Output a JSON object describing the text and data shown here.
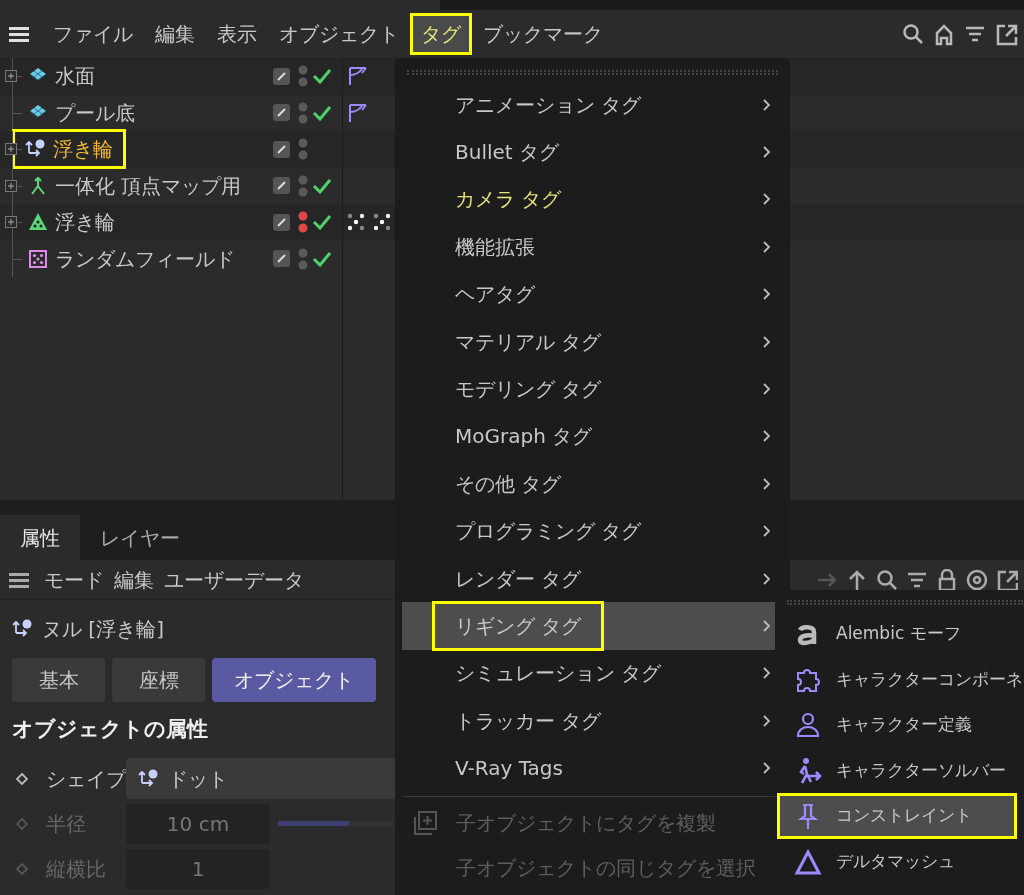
{
  "menubar": {
    "items": [
      {
        "label": "ファイル",
        "selected": false,
        "highlighted": false
      },
      {
        "label": "編集",
        "selected": false,
        "highlighted": false
      },
      {
        "label": "表示",
        "selected": false,
        "highlighted": false
      },
      {
        "label": "オブジェクト",
        "selected": false,
        "highlighted": false
      },
      {
        "label": "タグ",
        "selected": true,
        "highlighted": true
      },
      {
        "label": "ブックマーク",
        "selected": false,
        "highlighted": false
      }
    ]
  },
  "object_list": {
    "rows": [
      {
        "name": "水面",
        "kind": "plane",
        "expandable": true,
        "selected": false,
        "highlighted": false,
        "color": "#5a5a5a",
        "checked": true,
        "tags": [
          {
            "kind": "phong"
          }
        ]
      },
      {
        "name": "プール底",
        "kind": "plane",
        "expandable": false,
        "selected": false,
        "highlighted": false,
        "color": "#5a5a5a",
        "checked": true,
        "tags": [
          {
            "kind": "phong"
          }
        ]
      },
      {
        "name": "浮き輪",
        "kind": "null",
        "expandable": true,
        "selected": true,
        "highlighted": true,
        "color": "#5a5a5a",
        "checked": false
      },
      {
        "name": "一体化 頂点マップ用",
        "kind": "connect",
        "expandable": true,
        "selected": false,
        "highlighted": false,
        "color": "#5a5a5a",
        "checked": true
      },
      {
        "name": "浮き輪",
        "kind": "cloner",
        "expandable": true,
        "selected": false,
        "highlighted": false,
        "color": "#e04848",
        "checked": true,
        "tags": [
          {
            "kind": "dots"
          },
          {
            "kind": "dots"
          }
        ]
      },
      {
        "name": "ランダムフィールド",
        "kind": "field",
        "expandable": false,
        "selected": false,
        "highlighted": false,
        "color": "#5a5a5a",
        "checked": true
      }
    ]
  },
  "attributes": {
    "tabs": [
      {
        "label": "属性",
        "selected": true
      },
      {
        "label": "レイヤー",
        "selected": false
      }
    ],
    "menu": [
      "モード",
      "編集",
      "ユーザーデータ"
    ],
    "object_title": "ヌル [浮き輪]",
    "sub_tabs": [
      {
        "label": "基本",
        "selected": false
      },
      {
        "label": "座標",
        "selected": false
      },
      {
        "label": "オブジェクト",
        "selected": true
      }
    ],
    "section_title": "オブジェクトの属性",
    "fields": [
      {
        "kind": "dropdown",
        "label": "シェイプ",
        "value": "ドット",
        "disabled": false
      },
      {
        "kind": "slider",
        "label": "半径",
        "value": "10 cm",
        "disabled": true,
        "level": 0.62
      },
      {
        "kind": "number",
        "label": "縦横比",
        "value": "1",
        "disabled": true
      }
    ]
  },
  "tag_menu": {
    "items": [
      {
        "label": "アニメーション タグ",
        "accent": false,
        "selected": false,
        "highlighted": false
      },
      {
        "label": "Bullet タグ",
        "accent": false,
        "selected": false,
        "highlighted": false
      },
      {
        "label": "カメラ タグ",
        "accent": true,
        "selected": false,
        "highlighted": false
      },
      {
        "label": "機能拡張",
        "accent": false,
        "selected": false,
        "highlighted": false
      },
      {
        "label": "ヘアタグ",
        "accent": false,
        "selected": false,
        "highlighted": false
      },
      {
        "label": "マテリアル タグ",
        "accent": false,
        "selected": false,
        "highlighted": false
      },
      {
        "label": "モデリング タグ",
        "accent": false,
        "selected": false,
        "highlighted": false
      },
      {
        "label": "MoGraph タグ",
        "accent": false,
        "selected": false,
        "highlighted": false
      },
      {
        "label": "その他 タグ",
        "accent": false,
        "selected": false,
        "highlighted": false
      },
      {
        "label": "プログラミング タグ",
        "accent": false,
        "selected": false,
        "highlighted": false
      },
      {
        "label": "レンダー タグ",
        "accent": false,
        "selected": false,
        "highlighted": false
      },
      {
        "label": "リギング タグ",
        "accent": false,
        "selected": true,
        "highlighted": true
      },
      {
        "label": "シミュレーション タグ",
        "accent": false,
        "selected": false,
        "highlighted": false
      },
      {
        "label": "トラッカー タグ",
        "accent": false,
        "selected": false,
        "highlighted": false
      },
      {
        "label": "V-Ray Tags",
        "accent": false,
        "selected": false,
        "highlighted": false
      }
    ],
    "actions": [
      {
        "label": "子オブジェクトにタグを複製",
        "kind": "copy",
        "disabled": true
      },
      {
        "label": "子オブジェクトの同じタグを選択",
        "kind": "plain",
        "disabled": true
      }
    ]
  },
  "rigging_submenu": {
    "items": [
      {
        "label": "Alembic モーフ",
        "kind": "letter",
        "selected": false,
        "highlighted": false
      },
      {
        "label": "キャラクターコンポーネ",
        "kind": "puzzle",
        "selected": false,
        "highlighted": false
      },
      {
        "label": "キャラクター定義",
        "kind": "person",
        "selected": false,
        "highlighted": false
      },
      {
        "label": "キャラクターソルバー",
        "kind": "walker",
        "selected": false,
        "highlighted": false
      },
      {
        "label": "コンストレイント",
        "kind": "pin",
        "selected": true,
        "highlighted": true
      },
      {
        "label": "デルタマッシュ",
        "kind": "triangle",
        "selected": false,
        "highlighted": false
      }
    ]
  }
}
